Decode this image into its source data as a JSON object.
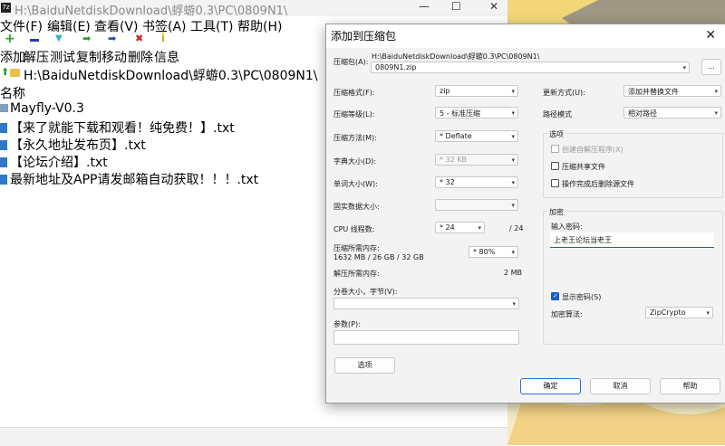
{
  "bg_window": {
    "title": "H:\\BaiduNetdiskDownload\\蜉蝣0.3\\PC\\0809N1\\",
    "menu": [
      "文件(F)",
      "编辑(E)",
      "查看(V)",
      "书签(A)",
      "工具(T)",
      "帮助(H)"
    ],
    "toolbar": [
      {
        "label": "添加",
        "icon": "plus-icon",
        "color": "#1aa31a"
      },
      {
        "label": "解压",
        "icon": "minus-icon",
        "color": "#1f3fb0"
      },
      {
        "label": "测试",
        "icon": "chevron-down-icon",
        "color": "#2ab7b7"
      },
      {
        "label": "复制",
        "icon": "arrow-right-icon",
        "color": "#1aa31a"
      },
      {
        "label": "移动",
        "icon": "arrow-right-icon",
        "color": "#1f3fb0"
      },
      {
        "label": "删除",
        "icon": "x-icon",
        "color": "#d02020"
      },
      {
        "label": "信息",
        "icon": "info-icon",
        "color": "#d0b000"
      }
    ],
    "address": "H:\\BaiduNetdiskDownload\\蜉蝣0.3\\PC\\0809N1\\",
    "column_name": "名称",
    "files": [
      {
        "name": "Mayfly-V0.3",
        "type": "folder"
      },
      {
        "name": "【来了就能下载和观看！纯免费！】.txt",
        "type": "file"
      },
      {
        "name": "【永久地址发布页】.txt",
        "type": "file"
      },
      {
        "name": "【论坛介绍】.txt",
        "type": "file"
      },
      {
        "name": "最新地址及APP请发邮箱自动获取！！！.txt",
        "type": "file"
      }
    ]
  },
  "dialog": {
    "title": "添加到压缩包",
    "close": "✕",
    "archive_label": "压缩包(A):",
    "archive_path": "H:\\BaiduNetdiskDownload\\蜉蝣0.3\\PC\\0809N1\\",
    "archive_name": "0809N1.zip",
    "browse_label": "...",
    "format_label": "压缩格式(F):",
    "format_value": "zip",
    "level_label": "压缩等级(L):",
    "level_value": "5 - 标准压缩",
    "method_label": "压缩方法(M):",
    "method_value": "* Deflate",
    "dict_label": "字典大小(D):",
    "dict_value": "* 32 KB",
    "word_label": "单词大小(W):",
    "word_value": "* 32",
    "solid_label": "固实数据大小:",
    "solid_value": "",
    "threads_label": "CPU 线程数:",
    "threads_value": "* 24",
    "threads_total": "/ 24",
    "mem_label": "压缩所需内存:",
    "mem_detail": "1632 MB / 26 GB / 32 GB",
    "mem_value": "* 80%",
    "decomp_label": "解压所需内存:",
    "decomp_value": "2 MB",
    "split_label": "分卷大小，字节(V):",
    "split_value": "",
    "params_label": "参数(P):",
    "params_value": "",
    "options_button": "选项",
    "update_label": "更新方式(U):",
    "update_value": "添加并替换文件",
    "path_label": "路径模式",
    "path_value": "相对路径",
    "options_group": "选项",
    "opt_sfx": "创建自解压程序(X)",
    "opt_shared": "压缩共享文件",
    "opt_delete": "操作完成后删除源文件",
    "encrypt_group": "加密",
    "password_label": "输入密码:",
    "password_value": "上老王论坛当老王",
    "show_password": "显示密码(S)",
    "enc_method_label": "加密算法:",
    "enc_method_value": "ZipCrypto",
    "ok_button": "确定",
    "cancel_button": "取消",
    "help_button": "帮助"
  }
}
